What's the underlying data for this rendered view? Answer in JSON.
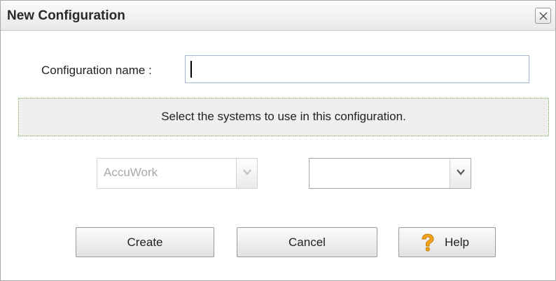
{
  "dialog": {
    "title": "New Configuration",
    "close_icon": "close-icon"
  },
  "form": {
    "name_label": "Configuration name :",
    "name_value": "",
    "info_text": "Select the systems to use in this configuration."
  },
  "systems": {
    "first_select_value": "AccuWork",
    "second_select_value": ""
  },
  "buttons": {
    "create_label": "Create",
    "cancel_label": "Cancel",
    "help_label": "Help",
    "help_icon": "question-icon"
  },
  "colors": {
    "info_border": "#79b24c",
    "help_icon": "#f2a51c"
  }
}
